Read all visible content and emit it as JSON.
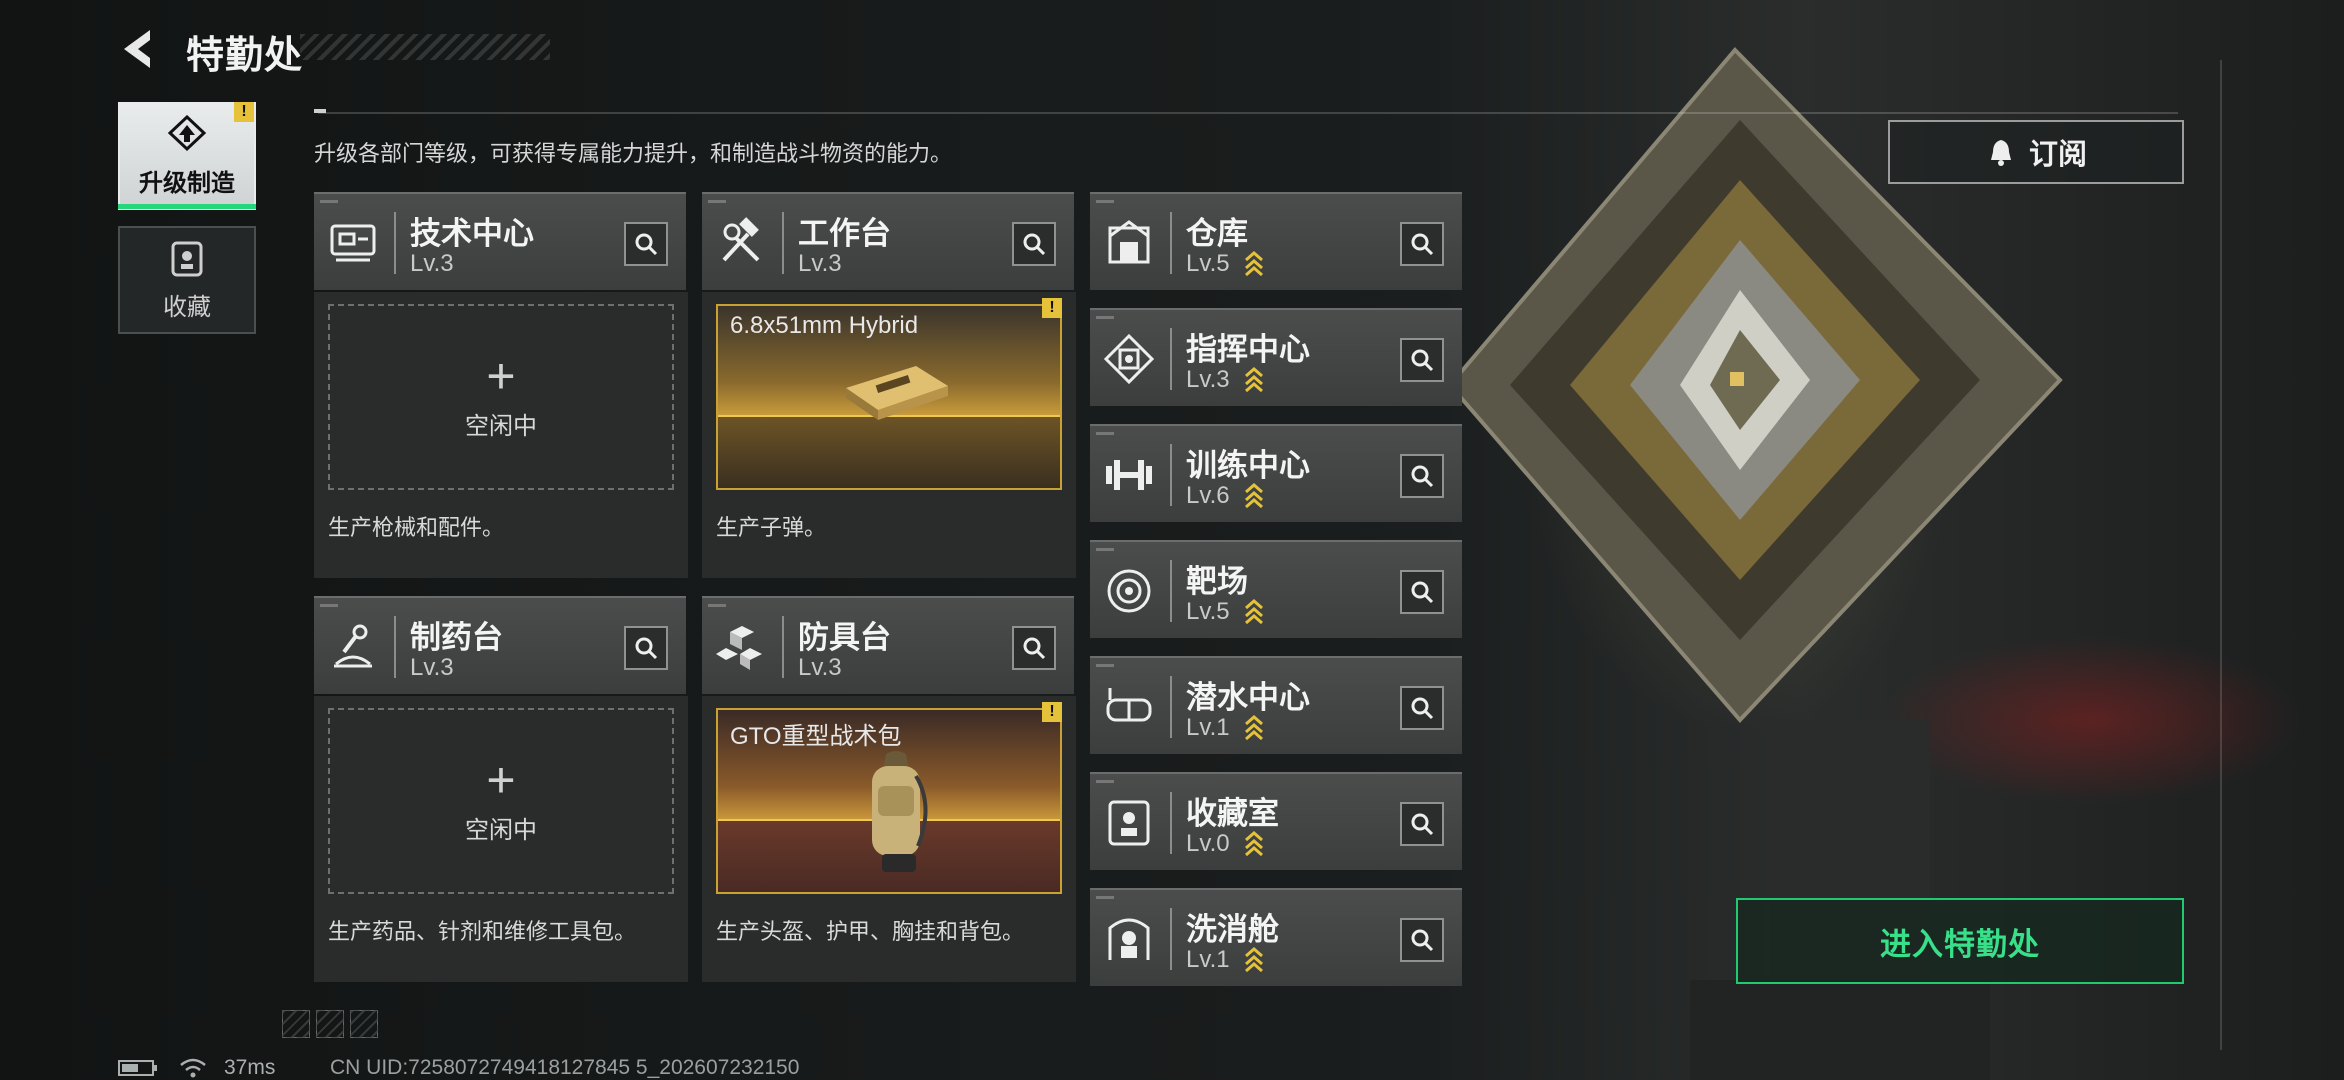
{
  "header": {
    "title": "特勤处",
    "description": "升级各部门等级，可获得专属能力提升，和制造战斗物资的能力。"
  },
  "tabs": [
    {
      "label": "升级制造",
      "icon": "upgrade-icon",
      "active": true,
      "alert": "!"
    },
    {
      "label": "收藏",
      "icon": "collection-icon",
      "active": false
    }
  ],
  "facilities_left": [
    {
      "name": "技术中心",
      "level": "Lv.3",
      "icon": "tech-center-icon",
      "panel": {
        "type": "idle",
        "plus": "+",
        "status": "空闲中",
        "desc": "生产枪械和配件。"
      }
    },
    {
      "name": "工作台",
      "level": "Lv.3",
      "icon": "workbench-icon",
      "panel": {
        "type": "item",
        "item": "6.8x51mm Hybrid",
        "alert": "!",
        "desc": "生产子弹。"
      }
    },
    {
      "name": "制药台",
      "level": "Lv.3",
      "icon": "pharmacy-icon",
      "panel": {
        "type": "idle",
        "plus": "+",
        "status": "空闲中",
        "desc": "生产药品、针剂和维修工具包。"
      }
    },
    {
      "name": "防具台",
      "level": "Lv.3",
      "icon": "armor-bench-icon",
      "panel": {
        "type": "item",
        "item": "GTO重型战术包",
        "alert": "!",
        "desc": "生产头盔、护甲、胸挂和背包。"
      }
    }
  ],
  "facilities_right": [
    {
      "name": "仓库",
      "level": "Lv.5",
      "icon": "warehouse-icon",
      "upgradable": true
    },
    {
      "name": "指挥中心",
      "level": "Lv.3",
      "icon": "command-center-icon",
      "upgradable": true
    },
    {
      "name": "训练中心",
      "level": "Lv.6",
      "icon": "training-center-icon",
      "upgradable": true
    },
    {
      "name": "靶场",
      "level": "Lv.5",
      "icon": "shooting-range-icon",
      "upgradable": true
    },
    {
      "name": "潜水中心",
      "level": "Lv.1",
      "icon": "diving-center-icon",
      "upgradable": true
    },
    {
      "name": "收藏室",
      "level": "Lv.0",
      "icon": "collection-room-icon",
      "upgradable": true
    },
    {
      "name": "洗消舱",
      "level": "Lv.1",
      "icon": "decontamination-icon",
      "upgradable": true
    }
  ],
  "buttons": {
    "subscribe": "订阅",
    "enter": "进入特勤处"
  },
  "status_bar": {
    "ping": "37ms",
    "uid": "CN UID:7258072749418127845 5_202607232150"
  },
  "colors": {
    "accent_green": "#25d67a",
    "alert_yellow": "#e6c23a",
    "item_gold": "#c9a233"
  }
}
